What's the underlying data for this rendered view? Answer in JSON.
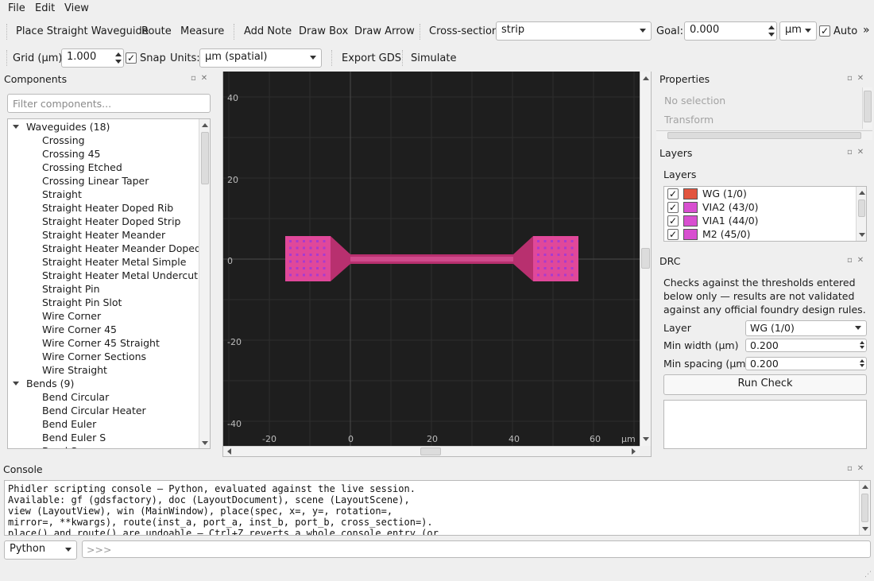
{
  "menubar": {
    "items": [
      "File",
      "Edit",
      "View"
    ]
  },
  "toolbar1": {
    "place_straight": "Place Straight Waveguide",
    "route": "Route",
    "measure": "Measure",
    "add_note": "Add Note",
    "draw_box": "Draw Box",
    "draw_arrow": "Draw Arrow",
    "cross_section_label": "Cross-section:",
    "cross_section_value": "strip",
    "goal_label": "Goal:",
    "goal_value": "0.000",
    "goal_unit": "µm",
    "auto_label": "Auto",
    "auto_checked": true,
    "overflow": "»"
  },
  "toolbar2": {
    "grid_label": "Grid (µm):",
    "grid_value": "1.000",
    "snap_label": "Snap",
    "snap_checked": true,
    "units_label": "Units:",
    "units_value": "µm  (spatial)",
    "export_gds": "Export GDS",
    "simulate": "Simulate"
  },
  "components": {
    "title": "Components",
    "filter_placeholder": "Filter components...",
    "groups": [
      {
        "label": "Waveguides (18)",
        "items": [
          "Crossing",
          "Crossing 45",
          "Crossing Etched",
          "Crossing Linear Taper",
          "Straight",
          "Straight Heater Doped Rib",
          "Straight Heater Doped Strip",
          "Straight Heater Meander",
          "Straight Heater Meander Doped",
          "Straight Heater Metal Simple",
          "Straight Heater Metal Undercut",
          "Straight Pin",
          "Straight Pin Slot",
          "Wire Corner",
          "Wire Corner 45",
          "Wire Corner 45 Straight",
          "Wire Corner Sections",
          "Wire Straight"
        ]
      },
      {
        "label": "Bends (9)",
        "items": [
          "Bend Circular",
          "Bend Circular Heater",
          "Bend Euler",
          "Bend Euler S",
          "Bend S"
        ]
      }
    ]
  },
  "canvas": {
    "y_ticks": [
      "40",
      "20",
      "0",
      "-20",
      "-40"
    ],
    "x_ticks": [
      "-20",
      "0",
      "20",
      "40",
      "60"
    ],
    "unit": "µm",
    "colors": {
      "background": "#1e1e1e",
      "pad": "#e0489a",
      "wg": "#b8306f"
    }
  },
  "properties": {
    "title": "Properties",
    "no_selection": "No selection",
    "transform": "Transform"
  },
  "layers": {
    "title": "Layers",
    "subtitle": "Layers",
    "items": [
      {
        "name": "WG  (1/0)",
        "color": "#e2553f",
        "checked": true
      },
      {
        "name": "VIA2  (43/0)",
        "color": "#d84fd0",
        "checked": true
      },
      {
        "name": "VIA1  (44/0)",
        "color": "#d84fd0",
        "checked": true
      },
      {
        "name": "M2  (45/0)",
        "color": "#d84fd0",
        "checked": true
      }
    ]
  },
  "drc": {
    "title": "DRC",
    "description": "Checks against the thresholds entered below only — results are not validated against any official foundry design rules.",
    "layer_label": "Layer",
    "layer_value": "WG (1/0)",
    "min_width_label": "Min width (µm)",
    "min_width_value": "0.200",
    "min_spacing_label": "Min spacing (µm)",
    "min_spacing_value": "0.200",
    "run_check": "Run Check"
  },
  "console": {
    "title": "Console",
    "lines": [
      "Phidler scripting console — Python, evaluated against the live session.",
      "Available: gf (gdsfactory), doc (LayoutDocument), scene (LayoutScene),",
      "view (LayoutView), win (MainWindow), place(spec, x=, y=, rotation=,",
      "mirror=, **kwargs), route(inst_a, port_a, inst_b, port_b, cross_section=).",
      "place() and route() are undoable — Ctrl+Z reverts a whole console entry (or"
    ],
    "language": "Python",
    "prompt_placeholder": ">>>"
  }
}
